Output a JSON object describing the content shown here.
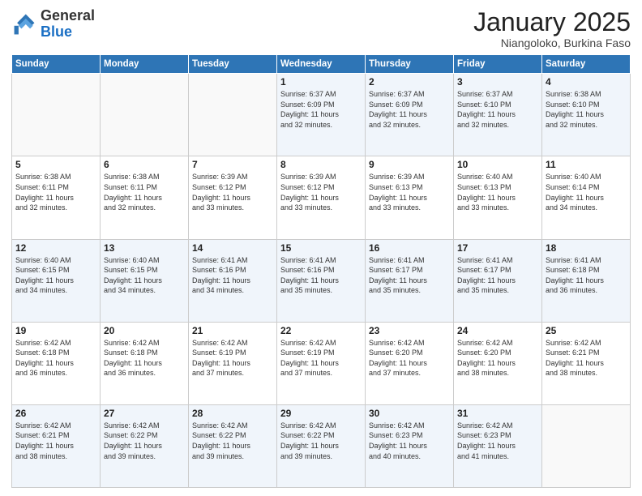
{
  "header": {
    "logo_general": "General",
    "logo_blue": "Blue",
    "month_title": "January 2025",
    "location": "Niangoloko, Burkina Faso"
  },
  "days_of_week": [
    "Sunday",
    "Monday",
    "Tuesday",
    "Wednesday",
    "Thursday",
    "Friday",
    "Saturday"
  ],
  "weeks": [
    [
      {
        "day": "",
        "info": ""
      },
      {
        "day": "",
        "info": ""
      },
      {
        "day": "",
        "info": ""
      },
      {
        "day": "1",
        "info": "Sunrise: 6:37 AM\nSunset: 6:09 PM\nDaylight: 11 hours\nand 32 minutes."
      },
      {
        "day": "2",
        "info": "Sunrise: 6:37 AM\nSunset: 6:09 PM\nDaylight: 11 hours\nand 32 minutes."
      },
      {
        "day": "3",
        "info": "Sunrise: 6:37 AM\nSunset: 6:10 PM\nDaylight: 11 hours\nand 32 minutes."
      },
      {
        "day": "4",
        "info": "Sunrise: 6:38 AM\nSunset: 6:10 PM\nDaylight: 11 hours\nand 32 minutes."
      }
    ],
    [
      {
        "day": "5",
        "info": "Sunrise: 6:38 AM\nSunset: 6:11 PM\nDaylight: 11 hours\nand 32 minutes."
      },
      {
        "day": "6",
        "info": "Sunrise: 6:38 AM\nSunset: 6:11 PM\nDaylight: 11 hours\nand 32 minutes."
      },
      {
        "day": "7",
        "info": "Sunrise: 6:39 AM\nSunset: 6:12 PM\nDaylight: 11 hours\nand 33 minutes."
      },
      {
        "day": "8",
        "info": "Sunrise: 6:39 AM\nSunset: 6:12 PM\nDaylight: 11 hours\nand 33 minutes."
      },
      {
        "day": "9",
        "info": "Sunrise: 6:39 AM\nSunset: 6:13 PM\nDaylight: 11 hours\nand 33 minutes."
      },
      {
        "day": "10",
        "info": "Sunrise: 6:40 AM\nSunset: 6:13 PM\nDaylight: 11 hours\nand 33 minutes."
      },
      {
        "day": "11",
        "info": "Sunrise: 6:40 AM\nSunset: 6:14 PM\nDaylight: 11 hours\nand 34 minutes."
      }
    ],
    [
      {
        "day": "12",
        "info": "Sunrise: 6:40 AM\nSunset: 6:15 PM\nDaylight: 11 hours\nand 34 minutes."
      },
      {
        "day": "13",
        "info": "Sunrise: 6:40 AM\nSunset: 6:15 PM\nDaylight: 11 hours\nand 34 minutes."
      },
      {
        "day": "14",
        "info": "Sunrise: 6:41 AM\nSunset: 6:16 PM\nDaylight: 11 hours\nand 34 minutes."
      },
      {
        "day": "15",
        "info": "Sunrise: 6:41 AM\nSunset: 6:16 PM\nDaylight: 11 hours\nand 35 minutes."
      },
      {
        "day": "16",
        "info": "Sunrise: 6:41 AM\nSunset: 6:17 PM\nDaylight: 11 hours\nand 35 minutes."
      },
      {
        "day": "17",
        "info": "Sunrise: 6:41 AM\nSunset: 6:17 PM\nDaylight: 11 hours\nand 35 minutes."
      },
      {
        "day": "18",
        "info": "Sunrise: 6:41 AM\nSunset: 6:18 PM\nDaylight: 11 hours\nand 36 minutes."
      }
    ],
    [
      {
        "day": "19",
        "info": "Sunrise: 6:42 AM\nSunset: 6:18 PM\nDaylight: 11 hours\nand 36 minutes."
      },
      {
        "day": "20",
        "info": "Sunrise: 6:42 AM\nSunset: 6:18 PM\nDaylight: 11 hours\nand 36 minutes."
      },
      {
        "day": "21",
        "info": "Sunrise: 6:42 AM\nSunset: 6:19 PM\nDaylight: 11 hours\nand 37 minutes."
      },
      {
        "day": "22",
        "info": "Sunrise: 6:42 AM\nSunset: 6:19 PM\nDaylight: 11 hours\nand 37 minutes."
      },
      {
        "day": "23",
        "info": "Sunrise: 6:42 AM\nSunset: 6:20 PM\nDaylight: 11 hours\nand 37 minutes."
      },
      {
        "day": "24",
        "info": "Sunrise: 6:42 AM\nSunset: 6:20 PM\nDaylight: 11 hours\nand 38 minutes."
      },
      {
        "day": "25",
        "info": "Sunrise: 6:42 AM\nSunset: 6:21 PM\nDaylight: 11 hours\nand 38 minutes."
      }
    ],
    [
      {
        "day": "26",
        "info": "Sunrise: 6:42 AM\nSunset: 6:21 PM\nDaylight: 11 hours\nand 38 minutes."
      },
      {
        "day": "27",
        "info": "Sunrise: 6:42 AM\nSunset: 6:22 PM\nDaylight: 11 hours\nand 39 minutes."
      },
      {
        "day": "28",
        "info": "Sunrise: 6:42 AM\nSunset: 6:22 PM\nDaylight: 11 hours\nand 39 minutes."
      },
      {
        "day": "29",
        "info": "Sunrise: 6:42 AM\nSunset: 6:22 PM\nDaylight: 11 hours\nand 39 minutes."
      },
      {
        "day": "30",
        "info": "Sunrise: 6:42 AM\nSunset: 6:23 PM\nDaylight: 11 hours\nand 40 minutes."
      },
      {
        "day": "31",
        "info": "Sunrise: 6:42 AM\nSunset: 6:23 PM\nDaylight: 11 hours\nand 41 minutes."
      },
      {
        "day": "",
        "info": ""
      }
    ]
  ]
}
